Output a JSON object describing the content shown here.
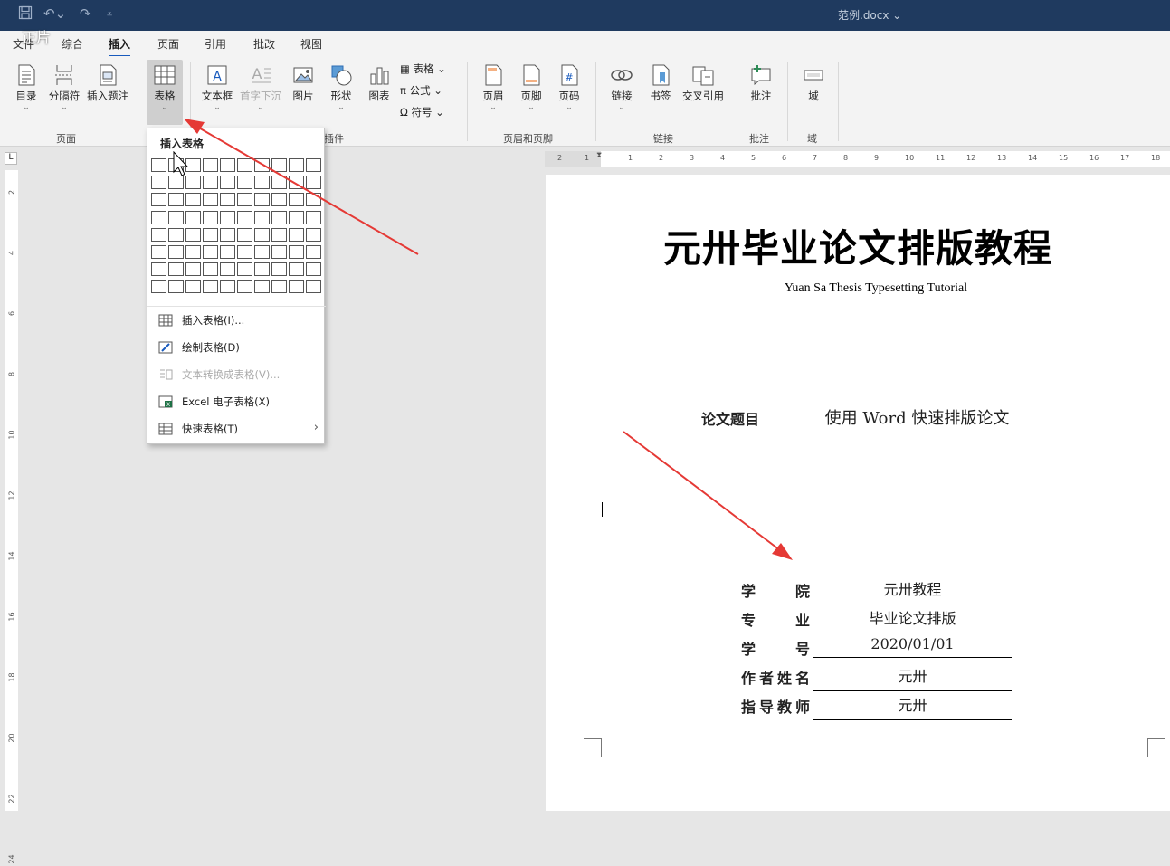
{
  "titlebar": {
    "doc_title": "范例.docx ⌄"
  },
  "watermark": "正片",
  "tabs": [
    "文件",
    "综合",
    "插入",
    "页面",
    "引用",
    "批改",
    "视图"
  ],
  "active_tab": "插入",
  "ribbon": {
    "page_group": {
      "label": "页面",
      "toc": "目录",
      "break": "分隔符",
      "caption": "插入题注"
    },
    "table_btn": "表格",
    "insert_group": {
      "label": "插件",
      "textbox": "文本框",
      "dropcap": "首字下沉",
      "picture": "图片",
      "shape": "形状",
      "chart": "图表",
      "table_small": "表格",
      "formula": "公式",
      "symbol": "符号"
    },
    "headerfooter_group": {
      "label": "页眉和页脚",
      "header": "页眉",
      "footer": "页脚",
      "pagenum": "页码"
    },
    "link_group": {
      "label": "链接",
      "link": "链接",
      "bookmark": "书签",
      "crossref": "交叉引用"
    },
    "comment_group": {
      "label": "批注",
      "comment": "批注"
    },
    "field_group": {
      "label": "域",
      "field": "域"
    }
  },
  "table_menu": {
    "header": "插入表格",
    "items": [
      {
        "label": "插入表格(I)...",
        "disabled": false
      },
      {
        "label": "绘制表格(D)",
        "disabled": false
      },
      {
        "label": "文本转换成表格(V)...",
        "disabled": true
      },
      {
        "label": "Excel 电子表格(X)",
        "disabled": false
      },
      {
        "label": "快速表格(T)",
        "disabled": false
      }
    ]
  },
  "ruler": {
    "horizontal": [
      "2",
      "1",
      "1",
      "2",
      "3",
      "4",
      "5",
      "6",
      "7",
      "8",
      "9",
      "10",
      "11",
      "12",
      "13",
      "14",
      "15",
      "16",
      "17",
      "18"
    ],
    "vertical": [
      "2",
      "4",
      "6",
      "8",
      "10",
      "12",
      "14",
      "16",
      "18",
      "20",
      "22",
      "24"
    ]
  },
  "document": {
    "title": "元卅毕业论文排版教程",
    "subtitle": "Yuan Sa Thesis Typesetting Tutorial",
    "thesis_label": "论文题目",
    "thesis_value": "使用 Word 快速排版论文",
    "fields": [
      {
        "label": "学院",
        "value": "元卅教程"
      },
      {
        "label": "专业",
        "value": "毕业论文排版"
      },
      {
        "label": "学号",
        "value": "2020/01/01"
      },
      {
        "label": "作者姓名",
        "value": "元卅"
      },
      {
        "label": "指导教师",
        "value": "元卅"
      }
    ]
  },
  "colors": {
    "titlebar": "#1f3a5f",
    "accent": "#185abd",
    "arrow": "#e53935"
  }
}
